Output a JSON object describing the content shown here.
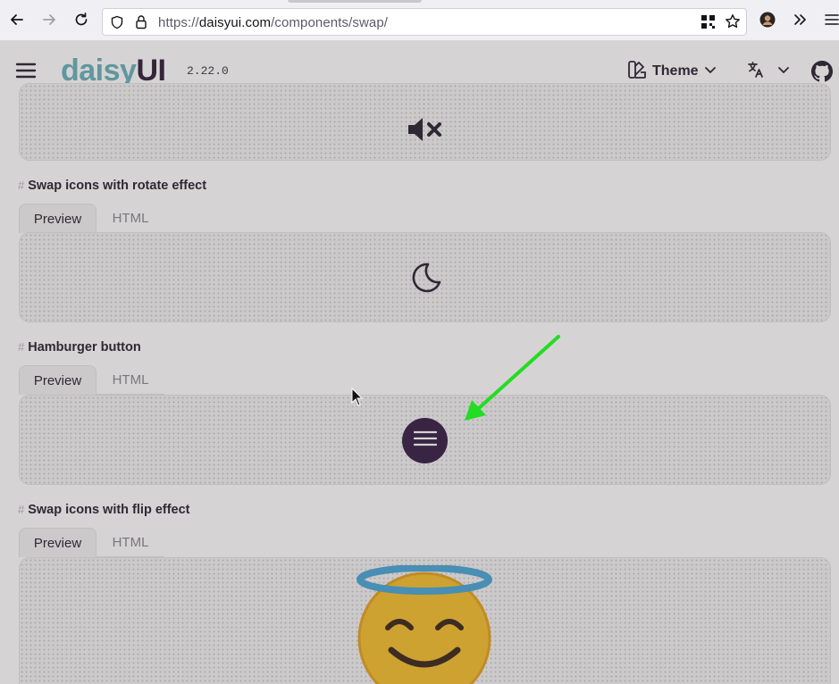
{
  "browser": {
    "url_prefix": "https://",
    "url_domain": "daisyui.com",
    "url_path": "/components/swap/",
    "icons": [
      "back-icon",
      "forward-icon",
      "reload-icon",
      "shield-icon",
      "lock-icon",
      "qr-code-icon",
      "bookmark-star-icon",
      "profile-avatar-icon",
      "overflow-chevrons-icon",
      "app-menu-icon"
    ]
  },
  "navbar": {
    "logo_part1": "daisy",
    "logo_part2": "UI",
    "version": "2.22.0",
    "theme_label": "Theme",
    "icons": [
      "hamburger-menu-icon",
      "theme-palette-icon",
      "translate-icon",
      "github-icon"
    ]
  },
  "sections": [
    {
      "id": "volume",
      "icon": "volume-mute-icon"
    },
    {
      "id": "rotate",
      "title": "Swap icons with rotate effect",
      "tab_preview": "Preview",
      "tab_html": "HTML",
      "icon": "moon-icon"
    },
    {
      "id": "hamburger",
      "title": "Hamburger button",
      "tab_preview": "Preview",
      "tab_html": "HTML",
      "icon": "hamburger-icon"
    },
    {
      "id": "flip",
      "title": "Swap icons with flip effect",
      "tab_preview": "Preview",
      "tab_html": "HTML",
      "emoji": "😇"
    }
  ],
  "annotation": {
    "color": "#22dd22"
  },
  "colors": {
    "logo_accent": "#69b2ba",
    "logo_dark": "#302139",
    "primary": "#362146"
  }
}
